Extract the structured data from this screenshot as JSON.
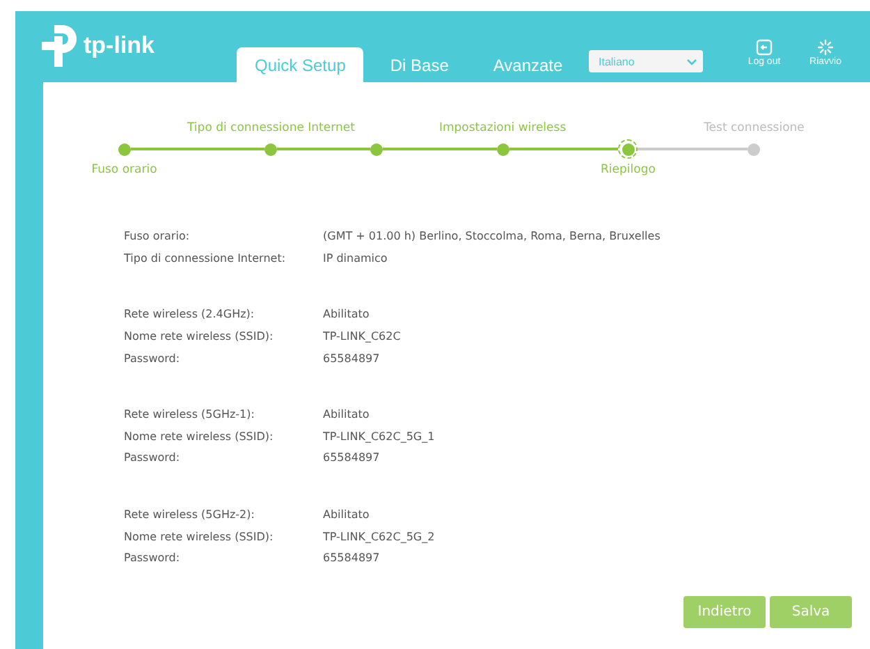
{
  "logo": {
    "text": "tp-link"
  },
  "tabs": [
    {
      "label": "Quick Setup",
      "selected": true
    },
    {
      "label": "Di Base",
      "selected": false
    },
    {
      "label": "Avanzate",
      "selected": false
    }
  ],
  "language_select": {
    "value": "Italiano"
  },
  "header_actions": [
    {
      "kind": "logout",
      "label": "Log out"
    },
    {
      "kind": "reboot",
      "label": "Riavvio"
    }
  ],
  "steps": [
    {
      "label": "Fuso orario",
      "completed": true,
      "selected": false
    },
    {
      "label": "Tipo di connessione Internet",
      "completed": true,
      "selected": false
    },
    {
      "completed": true,
      "selected": false
    },
    {
      "label": "Impostazioni wireless",
      "completed": true,
      "selected": false
    },
    {
      "label": "Riepilogo",
      "completed": false,
      "selected": true
    },
    {
      "label": "Test connessione",
      "completed": false,
      "selected": false
    }
  ],
  "summary_groups": [
    {
      "rows": [
        {
          "label": "Fuso orario:",
          "value": "(GMT + 01.00 h) Berlino, Stoccolma, Roma, Berna, Bruxelles"
        },
        {
          "label": "Tipo di connessione Internet:",
          "value": "IP dinamico"
        }
      ]
    },
    {
      "rows": [
        {
          "label": "Rete wireless (2.4GHz):",
          "value": "Abilitato"
        },
        {
          "label": "Nome rete wireless (SSID):",
          "value": "TP-LINK_C62C"
        },
        {
          "label": "Password:",
          "value": "65584897"
        }
      ]
    },
    {
      "rows": [
        {
          "label": "Rete wireless (5GHz-1):",
          "value": "Abilitato"
        },
        {
          "label": "Nome rete wireless (SSID):",
          "value": "TP-LINK_C62C_5G_1"
        },
        {
          "label": "Password:",
          "value": "65584897"
        }
      ]
    },
    {
      "rows": [
        {
          "label": "Rete wireless (5GHz-2):",
          "value": "Abilitato"
        },
        {
          "label": "Nome rete wireless (SSID):",
          "value": "TP-LINK_C62C_5G_2"
        },
        {
          "label": "Password:",
          "value": "65584897"
        }
      ]
    }
  ],
  "buttons": [
    {
      "label": "Indietro"
    },
    {
      "label": "Salva"
    }
  ]
}
